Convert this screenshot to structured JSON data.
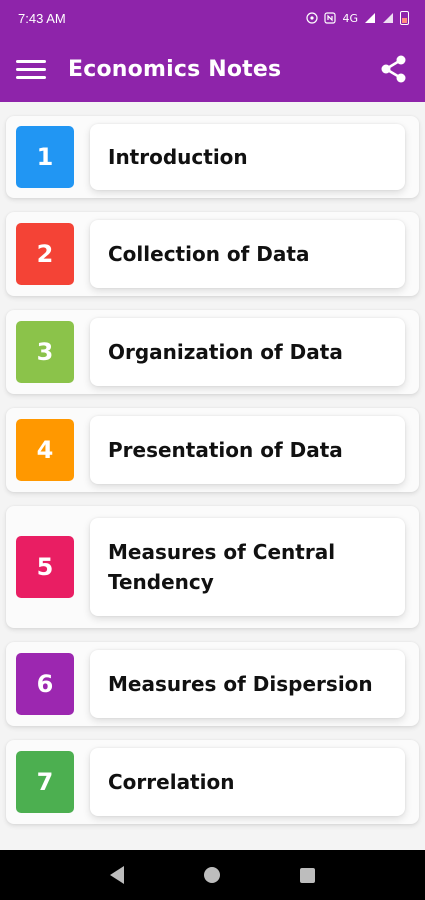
{
  "status_bar": {
    "time": "7:43 AM",
    "network_text": "4G"
  },
  "app_bar": {
    "title": "Economics Notes",
    "menu_icon": "hamburger-menu-icon",
    "share_icon": "share-icon",
    "color": "#8e24aa"
  },
  "chapters": [
    {
      "number": "1",
      "title": "Introduction",
      "color": "#2196f3"
    },
    {
      "number": "2",
      "title": "Collection of Data",
      "color": "#f44336"
    },
    {
      "number": "3",
      "title": "Organization of Data",
      "color": "#8bc34a"
    },
    {
      "number": "4",
      "title": "Presentation of Data",
      "color": "#ff9800"
    },
    {
      "number": "5",
      "title": "Measures of Central Tendency",
      "color": "#e91e63"
    },
    {
      "number": "6",
      "title": "Measures of Dispersion",
      "color": "#9c27b0"
    },
    {
      "number": "7",
      "title": "Correlation",
      "color": "#4caf50"
    }
  ],
  "nav_bar": {
    "back_icon": "back-triangle-icon",
    "home_icon": "home-circle-icon",
    "recents_icon": "recents-square-icon"
  }
}
